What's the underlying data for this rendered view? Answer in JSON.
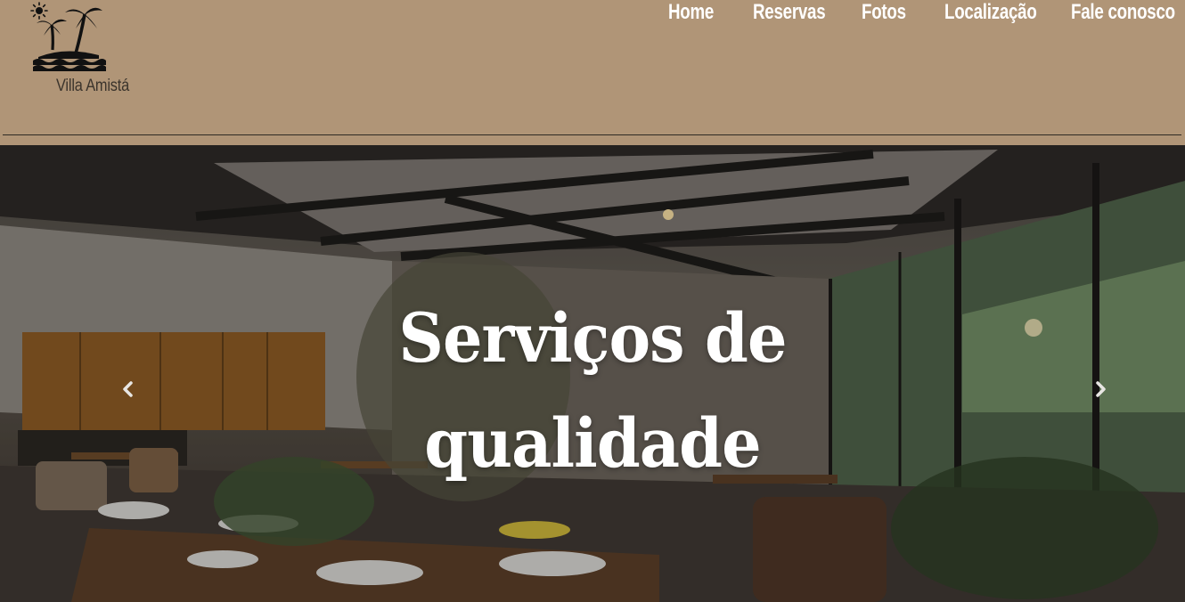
{
  "brand": {
    "name": "Villa Amistá"
  },
  "nav": [
    {
      "label": "Home"
    },
    {
      "label": "Reservas"
    },
    {
      "label": "Fotos"
    },
    {
      "label": "Localização"
    },
    {
      "label": "Fale conosco"
    }
  ],
  "hero": {
    "title_line1": "Serviços de",
    "title_line2": "qualidade"
  },
  "icons": {
    "logo": "palm-trees-sun-waves-icon",
    "prev": "chevron-left-icon",
    "next": "chevron-right-icon"
  },
  "colors": {
    "header_bg": "#b09577",
    "nav_text": "#ffffff",
    "brand_text": "#3b342c"
  }
}
